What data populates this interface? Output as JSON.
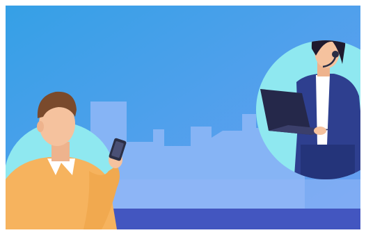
{
  "illustration": {
    "colors": {
      "sky_top": "#3aa4e8",
      "sky_bottom": "#7aa8f4",
      "skyline": "#8bb6f6",
      "floor": "#4356c0",
      "bubble": "#8fe8f0",
      "skin": "#f5c29e",
      "hair_man": "#7a4a2c",
      "sweater": "#f6b560",
      "phone": "#2b2f45",
      "hair_woman": "#1f1a2e",
      "blazer": "#2e3f8f",
      "laptop": "#25284a"
    },
    "icons": [
      "man-with-phone",
      "woman-with-laptop-and-headset"
    ]
  }
}
